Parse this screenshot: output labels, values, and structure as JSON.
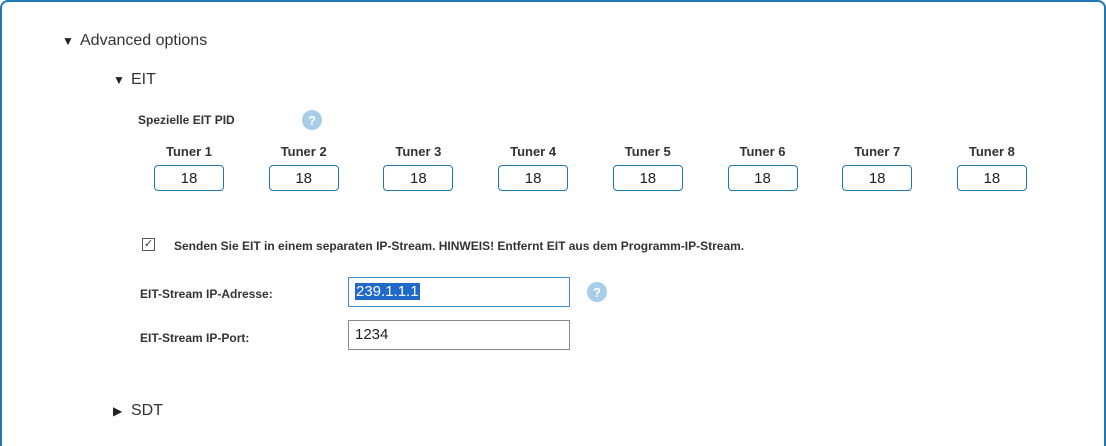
{
  "advanced": {
    "arrow": "▼",
    "label": "Advanced options"
  },
  "eit": {
    "arrow": "▼",
    "label": "EIT",
    "special_pid_label": "Spezielle EIT PID",
    "help_glyph": "?",
    "tuners": [
      {
        "name": "Tuner 1",
        "value": "18"
      },
      {
        "name": "Tuner 2",
        "value": "18"
      },
      {
        "name": "Tuner 3",
        "value": "18"
      },
      {
        "name": "Tuner 4",
        "value": "18"
      },
      {
        "name": "Tuner 5",
        "value": "18"
      },
      {
        "name": "Tuner 6",
        "value": "18"
      },
      {
        "name": "Tuner 7",
        "value": "18"
      },
      {
        "name": "Tuner 8",
        "value": "18"
      }
    ],
    "separate_stream": {
      "checked": true,
      "check_glyph": "✓",
      "label": "Senden Sie EIT in einem separaten IP-Stream. HINWEIS! Entfernt EIT aus dem Programm-IP-Stream."
    },
    "ip_address": {
      "label": "EIT-Stream IP-Adresse:",
      "value": "239.1.1.1"
    },
    "ip_port": {
      "label": "EIT-Stream IP-Port:",
      "value": "1234"
    }
  },
  "sdt": {
    "arrow": "▶",
    "label": "SDT"
  },
  "colors": {
    "accent": "#1f77b4",
    "help": "#a8cde8",
    "selection": "#1f69c8"
  }
}
